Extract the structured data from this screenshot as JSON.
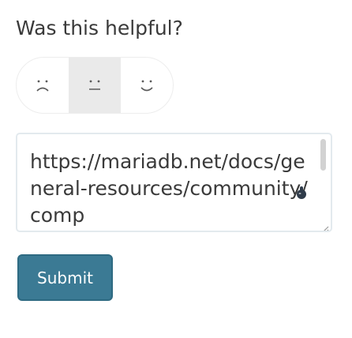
{
  "feedback": {
    "question": "Was this helpful?",
    "options": [
      {
        "name": "sad",
        "icon": "sad-face-icon"
      },
      {
        "name": "neutral",
        "icon": "neutral-face-icon",
        "selected": true
      },
      {
        "name": "happy",
        "icon": "happy-face-icon"
      }
    ],
    "textarea_value": "https://mariadb.net/docs/general-resources/community/comp",
    "submit_label": "Submit"
  },
  "colors": {
    "accent": "#3b7a94",
    "selected_bg": "#eaeaea",
    "border": "#e3eaee",
    "text": "#3a3a3a"
  }
}
